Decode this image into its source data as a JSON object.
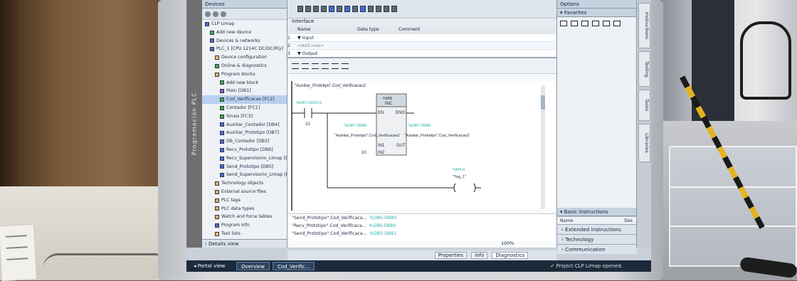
{
  "devices": {
    "tab_label": "Devices",
    "vertical_strip": "Programación PLC",
    "tree": [
      {
        "label": "CLP Limap",
        "icon": "project-icon",
        "depth": 0
      },
      {
        "label": "Add new device",
        "icon": "add-icon",
        "depth": 1
      },
      {
        "label": "Devices & networks",
        "icon": "network-icon",
        "depth": 1
      },
      {
        "label": "PLC_1 [CPU 1214C DC/DC/Rly]",
        "icon": "plc-icon",
        "depth": 1
      },
      {
        "label": "Device configuration",
        "icon": "config-icon",
        "depth": 2
      },
      {
        "label": "Online & diagnostics",
        "icon": "diagnostics-icon",
        "depth": 2
      },
      {
        "label": "Program blocks",
        "icon": "folder-icon",
        "depth": 2
      },
      {
        "label": "Add new block",
        "icon": "add-icon",
        "depth": 3
      },
      {
        "label": "Main [OB1]",
        "icon": "ob-icon",
        "depth": 3
      },
      {
        "label": "Cod_Verificacao [FC2]",
        "icon": "fc-icon",
        "depth": 3,
        "selected": true
      },
      {
        "label": "Contador [FC1]",
        "icon": "fc-icon",
        "depth": 3
      },
      {
        "label": "Sinais [FC3]",
        "icon": "fc-icon",
        "depth": 3
      },
      {
        "label": "Auxiliar_Contador [DB4]",
        "icon": "db-icon",
        "depth": 3
      },
      {
        "label": "Auxiliar_Prototipo [DB7]",
        "icon": "db-icon",
        "depth": 3
      },
      {
        "label": "DB_Contador [DB3]",
        "icon": "db-icon",
        "depth": 3
      },
      {
        "label": "Recv_Prototipo [DB6]",
        "icon": "db-icon",
        "depth": 3
      },
      {
        "label": "Recv_Supervisorio_Limap [DB2]",
        "icon": "db-icon",
        "depth": 3
      },
      {
        "label": "Send_Prototipo [DB5]",
        "icon": "db-icon",
        "depth": 3
      },
      {
        "label": "Send_Supervisorio_Limap [DB1]",
        "icon": "db-icon",
        "depth": 3
      },
      {
        "label": "Technology objects",
        "icon": "folder-icon",
        "depth": 2
      },
      {
        "label": "External source files",
        "icon": "folder-icon",
        "depth": 2
      },
      {
        "label": "PLC tags",
        "icon": "folder-icon",
        "depth": 2
      },
      {
        "label": "PLC data types",
        "icon": "folder-icon",
        "depth": 2
      },
      {
        "label": "Watch and force tables",
        "icon": "folder-icon",
        "depth": 2
      },
      {
        "label": "Program info",
        "icon": "info-icon",
        "depth": 2
      },
      {
        "label": "Text lists",
        "icon": "list-icon",
        "depth": 2
      }
    ],
    "details_view": "Details view"
  },
  "editor": {
    "interface_title": "Interface",
    "interface_headers": {
      "name": "Name",
      "data_type": "Data type",
      "comment": "Comment"
    },
    "interface_rows": [
      {
        "name": "▼ Input",
        "type": "",
        "comment": ""
      },
      {
        "name": "<Add new>",
        "type": "",
        "comment": ""
      },
      {
        "name": "▼ Output",
        "type": "",
        "comment": ""
      }
    ],
    "ladder": {
      "contact1_tag": "\"Auxiliar_Prototipo\".Cod_Verificacao2",
      "contact1_addr": "%DB7.DBX0.0",
      "contact1_sub": "10",
      "box_addr": "%MB",
      "box_title": "INC",
      "box_en": "EN",
      "box_eno": "ENO",
      "box_in1": "IN1",
      "box_in2": "IN2",
      "box_out": "OUT",
      "in1_tag": "\"Auxiliar_Prototipo\".Cod_Verificacao2",
      "in1_addr": "%DB7.DBB0",
      "in2_value": "10",
      "out_tag": "\"Auxiliar_Prototipo\".Cod_Verificacao2",
      "out_addr": "%DB7.DBB0",
      "coil_addr": "%M4.0",
      "coil_tag": "\"Tag_1\""
    },
    "xref": [
      {
        "name": "\"Send_Prototipo\".Cod_Verificaca...",
        "addr": "%DB5.DBB0"
      },
      {
        "name": "\"Recv_Prototipo\".Cod_Verificaca...",
        "addr": "%DB6.DBB0"
      },
      {
        "name": "\"Send_Prototipo\".Cod_Verificaca...",
        "addr": "%DB5.DBB1"
      }
    ],
    "zoom": "100%"
  },
  "options": {
    "title": "Options",
    "favorites": "Favorites",
    "basic_instructions": "Basic instructions",
    "bi_headers": {
      "name": "Name",
      "desc": "Des"
    },
    "groups": [
      "Extended instructions",
      "Technology",
      "Communication"
    ],
    "side_tabs": [
      "Instructions",
      "Testing",
      "Tasks",
      "Libraries"
    ]
  },
  "bottom_tabs": [
    "Properties",
    "Info",
    "Diagnostics"
  ],
  "portal_bar": {
    "portal_view": "Portal view",
    "tabs": [
      "Overview",
      "Cod_Verific..."
    ],
    "status": "Project CLP Limap opened."
  }
}
